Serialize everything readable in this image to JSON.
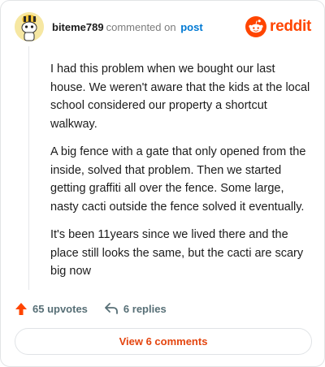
{
  "header": {
    "author": "biteme789",
    "action_text": "commented on",
    "post_link": "post",
    "brand": "reddit"
  },
  "comment": {
    "paragraphs": [
      "I had this problem when we bought our last house. We weren't aware that the kids at the local school considered our property a shortcut walkway.",
      "A big fence with a gate that only opened from the inside, solved that problem. Then we started getting graffiti all over the fence. Some large, nasty cacti outside the fence solved it eventually.",
      "It's been 11years since we lived there and the place still looks the same, but the cacti are scary big now"
    ]
  },
  "actions": {
    "upvotes": "65 upvotes",
    "replies": "6 replies"
  },
  "footer": {
    "view_comments": "View 6 comments"
  },
  "colors": {
    "brand": "#ff4500",
    "link": "#0079d3",
    "button_text": "#e4450f"
  },
  "icons": {
    "avatar": "snoo-avatar",
    "logo": "reddit-icon",
    "upvote": "upvote-arrow-icon",
    "reply": "reply-arrow-icon"
  }
}
